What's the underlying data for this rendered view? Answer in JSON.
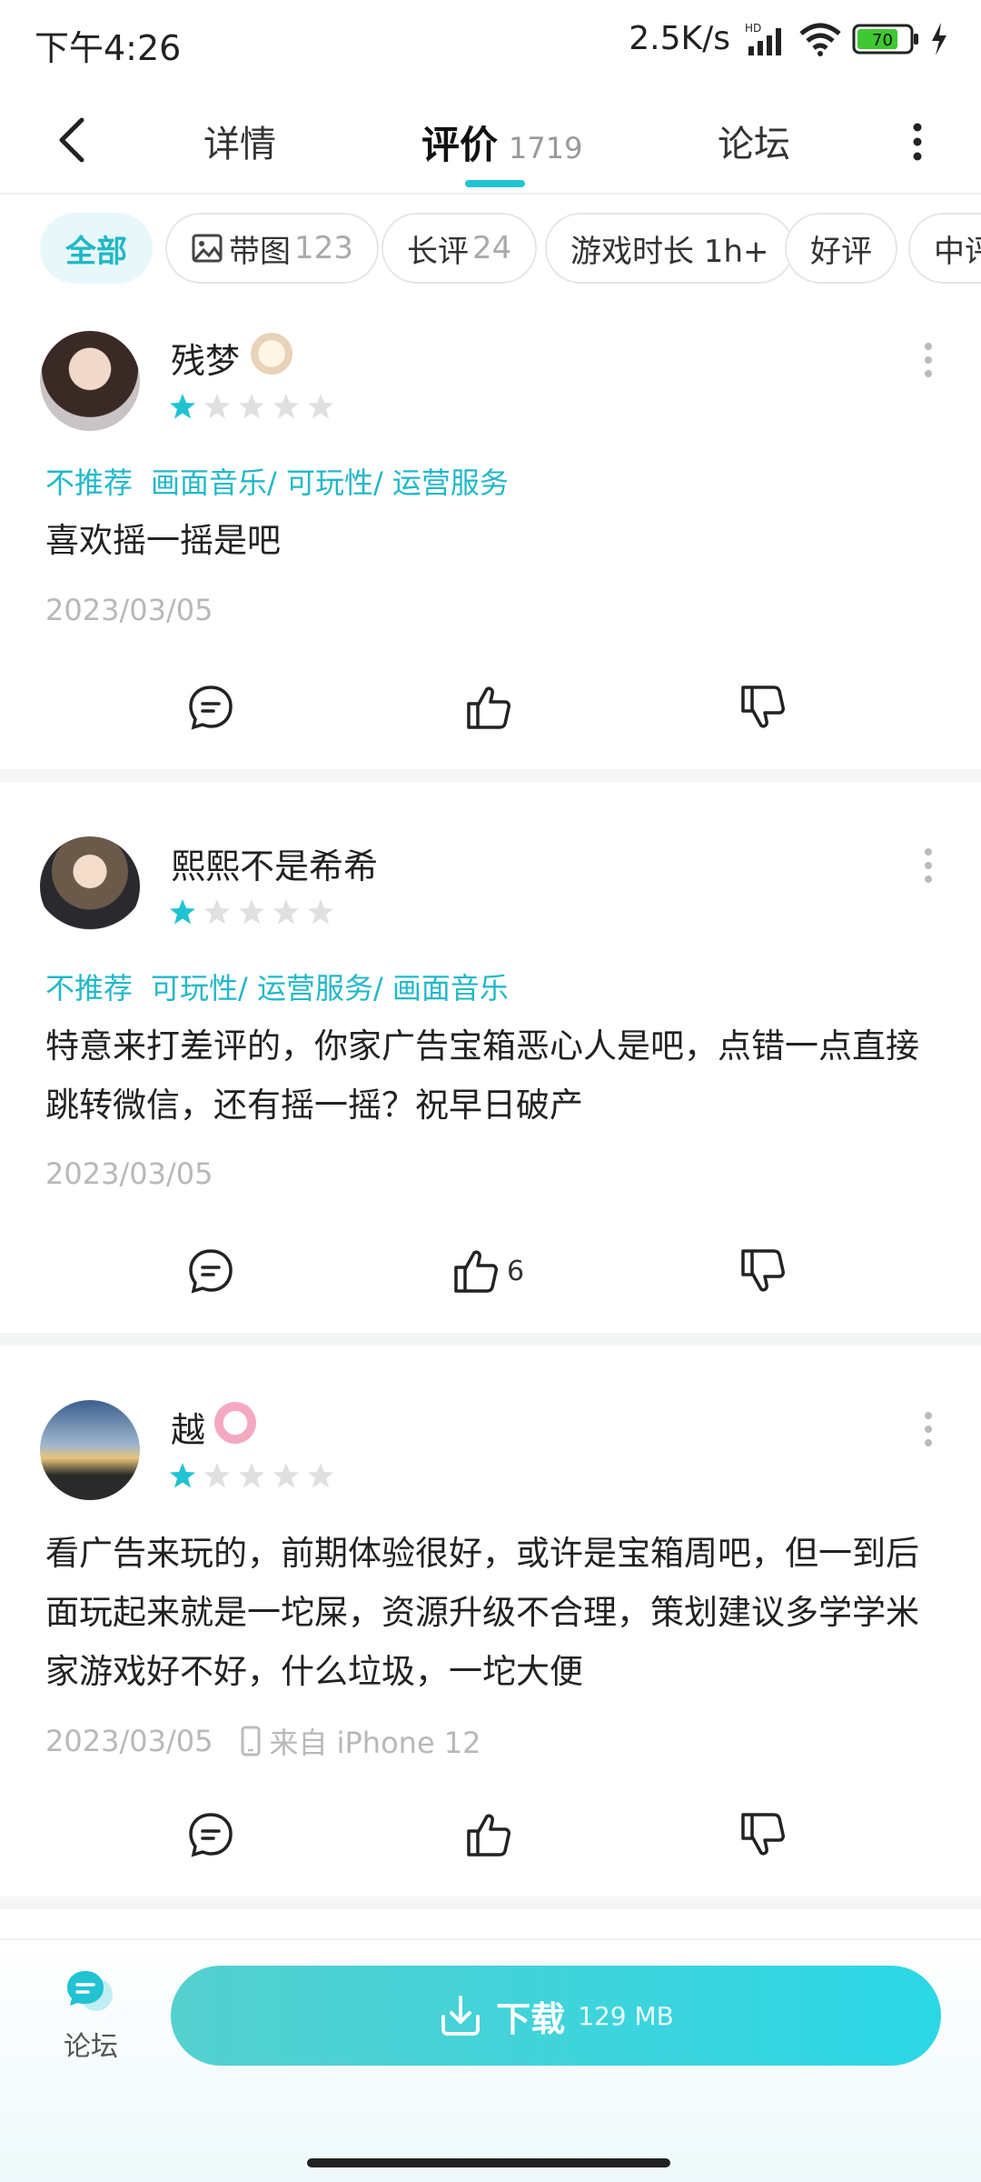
{
  "status_bar": {
    "time": "下午4:26",
    "speed": "2.5K/s",
    "battery": "70"
  },
  "nav": {
    "tabs": [
      "详情",
      "评价",
      "论坛"
    ],
    "review_count": "1719",
    "active_tab": "评价"
  },
  "filters": [
    {
      "label": "全部",
      "count": ""
    },
    {
      "label": "带图",
      "count": "123"
    },
    {
      "label": "长评",
      "count": "24"
    },
    {
      "label": "游戏时长 1h+",
      "count": ""
    },
    {
      "label": "好评",
      "count": ""
    },
    {
      "label": "中评",
      "count": ""
    }
  ],
  "reviews": [
    {
      "username": "残梦",
      "rating": 1,
      "tag_first": "不推荐",
      "tags": "画面音乐/ 可玩性/ 运营服务",
      "content": "喜欢摇一摇是吧",
      "date": "2023/03/05",
      "device": "",
      "likes": ""
    },
    {
      "username": "熙熙不是希希",
      "rating": 1,
      "tag_first": "不推荐",
      "tags": "可玩性/ 运营服务/ 画面音乐",
      "content": "特意来打差评的，你家广告宝箱恶心人是吧，点错一点直接跳转微信，还有摇一摇？祝早日破产",
      "date": "2023/03/05",
      "device": "",
      "likes": "6"
    },
    {
      "username": "越",
      "rating": 1,
      "tag_first": "",
      "tags": "",
      "content": "看广告来玩的，前期体验很好，或许是宝箱周吧，但一到后面玩起来就是一坨屎，资源升级不合理，策划建议多学学米家游戏好不好，什么垃圾，一坨大便",
      "date": "2023/03/05",
      "device": "来自 iPhone 12",
      "likes": ""
    }
  ],
  "bottom": {
    "forum_label": "论坛",
    "download_label": "下载",
    "download_size": "129 MB"
  },
  "colors": {
    "accent": "#21b8c8",
    "star_on": "#21c3d3",
    "star_off": "#e0e0e0"
  }
}
